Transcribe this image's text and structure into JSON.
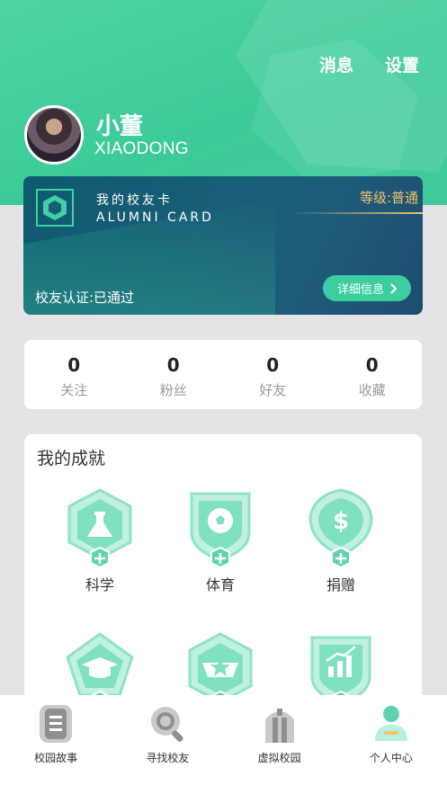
{
  "header": {
    "messages_label": "消息",
    "settings_label": "设置"
  },
  "user": {
    "name": "小董",
    "subtitle": "XIAODONG"
  },
  "card": {
    "title": "我的校友卡",
    "subtitle": "ALUMNI CARD",
    "level": "等级:普通",
    "status": "校友认证:已通过",
    "detail_label": "详细信息",
    "detail_icon": "chevron-right-icon"
  },
  "stats": [
    {
      "value": "0",
      "label": "关注"
    },
    {
      "value": "0",
      "label": "粉丝"
    },
    {
      "value": "0",
      "label": "好友"
    },
    {
      "value": "0",
      "label": "收藏"
    }
  ],
  "achievements": {
    "title": "我的成就",
    "items": [
      {
        "label": "科学",
        "icon": "flask-icon"
      },
      {
        "label": "体育",
        "icon": "soccer-ball-icon"
      },
      {
        "label": "捐赠",
        "icon": "dollar-icon"
      },
      {
        "label": "",
        "icon": "graduation-cap-icon"
      },
      {
        "label": "",
        "icon": "star-emblem-icon"
      },
      {
        "label": "",
        "icon": "chart-icon"
      }
    ]
  },
  "tabbar": [
    {
      "label": "校园故事",
      "icon": "document-icon"
    },
    {
      "label": "寻找校友",
      "icon": "search-icon"
    },
    {
      "label": "虚拟校园",
      "icon": "building-icon"
    },
    {
      "label": "个人中心",
      "icon": "person-icon"
    }
  ],
  "colors": {
    "accent": "#3ccb98",
    "card_bg": "#185e76",
    "gold": "#f2c46b"
  }
}
